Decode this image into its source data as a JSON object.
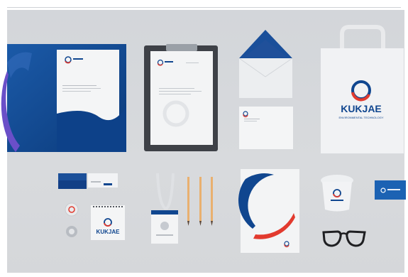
{
  "brand": {
    "name": "KUKJAE",
    "tagline": "ENVIRONMENTAL TECHNOLOGY",
    "colors": {
      "navy": "#10468f",
      "red": "#e23a2e",
      "purple": "#6a4fc8",
      "backdrop": "#d5d8dc",
      "paper": "#f4f5f6"
    }
  },
  "icons": [
    "ring-logo-icon",
    "clipboard-clip-icon",
    "paper-bag-handle-icon",
    "pencil-icon",
    "glasses-icon",
    "cup-lid-icon"
  ]
}
